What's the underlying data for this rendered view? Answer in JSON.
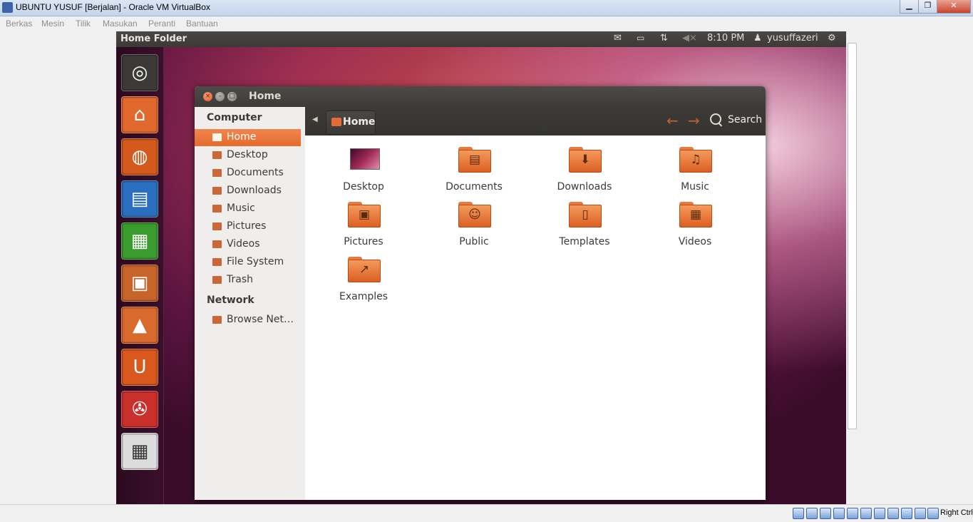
{
  "host": {
    "title": "UBUNTU YUSUF [Berjalan] - Oracle VM VirtualBox",
    "menu": [
      "Berkas",
      "Mesin",
      "Tilik",
      "Masukan",
      "Peranti",
      "Bantuan"
    ],
    "controls": {
      "minimize": "▁",
      "maximize": "❐",
      "close": "✕"
    },
    "host_key": "Right Ctrl"
  },
  "panel": {
    "title": "Home Folder",
    "time": "8:10 PM",
    "user": "yusuffazeri",
    "icons": [
      "mail-icon",
      "battery-icon",
      "network-icon",
      "volume-muted-icon",
      "user-icon",
      "gear-icon"
    ]
  },
  "launcher": [
    {
      "name": "dash-home",
      "glyph": "◎",
      "bg": "#3b3a37"
    },
    {
      "name": "home-folder",
      "glyph": "⌂",
      "bg": "#e2692e"
    },
    {
      "name": "firefox",
      "glyph": "◍",
      "bg": "#d35a1c"
    },
    {
      "name": "libreoffice-writer",
      "glyph": "▤",
      "bg": "#2a6fbf"
    },
    {
      "name": "libreoffice-calc",
      "glyph": "▦",
      "bg": "#3a9b2f"
    },
    {
      "name": "libreoffice-impress",
      "glyph": "▣",
      "bg": "#c7642a"
    },
    {
      "name": "software-center",
      "glyph": "▲",
      "bg": "#d96a2e"
    },
    {
      "name": "ubuntu-one",
      "glyph": "U",
      "bg": "#d9581e"
    },
    {
      "name": "system-settings",
      "glyph": "✇",
      "bg": "#c9302c"
    },
    {
      "name": "workspace-switcher",
      "glyph": "▦",
      "bg": "#dcdcdc"
    }
  ],
  "window": {
    "title": "Home",
    "path_button": "Home",
    "search_label": "Search"
  },
  "sidebar": {
    "computer_heading": "Computer",
    "computer_items": [
      "Home",
      "Desktop",
      "Documents",
      "Downloads",
      "Music",
      "Pictures",
      "Videos",
      "File System",
      "Trash"
    ],
    "selected": "Home",
    "network_heading": "Network",
    "network_items": [
      "Browse Net…"
    ]
  },
  "files": [
    {
      "name": "Desktop",
      "kind": "desktop",
      "glyph": ""
    },
    {
      "name": "Documents",
      "kind": "folder",
      "glyph": "▤"
    },
    {
      "name": "Downloads",
      "kind": "folder",
      "glyph": "⬇"
    },
    {
      "name": "Music",
      "kind": "folder",
      "glyph": "♫"
    },
    {
      "name": "Pictures",
      "kind": "folder",
      "glyph": "▣"
    },
    {
      "name": "Public",
      "kind": "folder",
      "glyph": "☺"
    },
    {
      "name": "Templates",
      "kind": "folder",
      "glyph": "▯"
    },
    {
      "name": "Videos",
      "kind": "folder",
      "glyph": "▦"
    },
    {
      "name": "Examples",
      "kind": "folder",
      "glyph": "↗"
    }
  ],
  "colors": {
    "accent": "#e66a2c",
    "panel": "#3c3b37"
  }
}
